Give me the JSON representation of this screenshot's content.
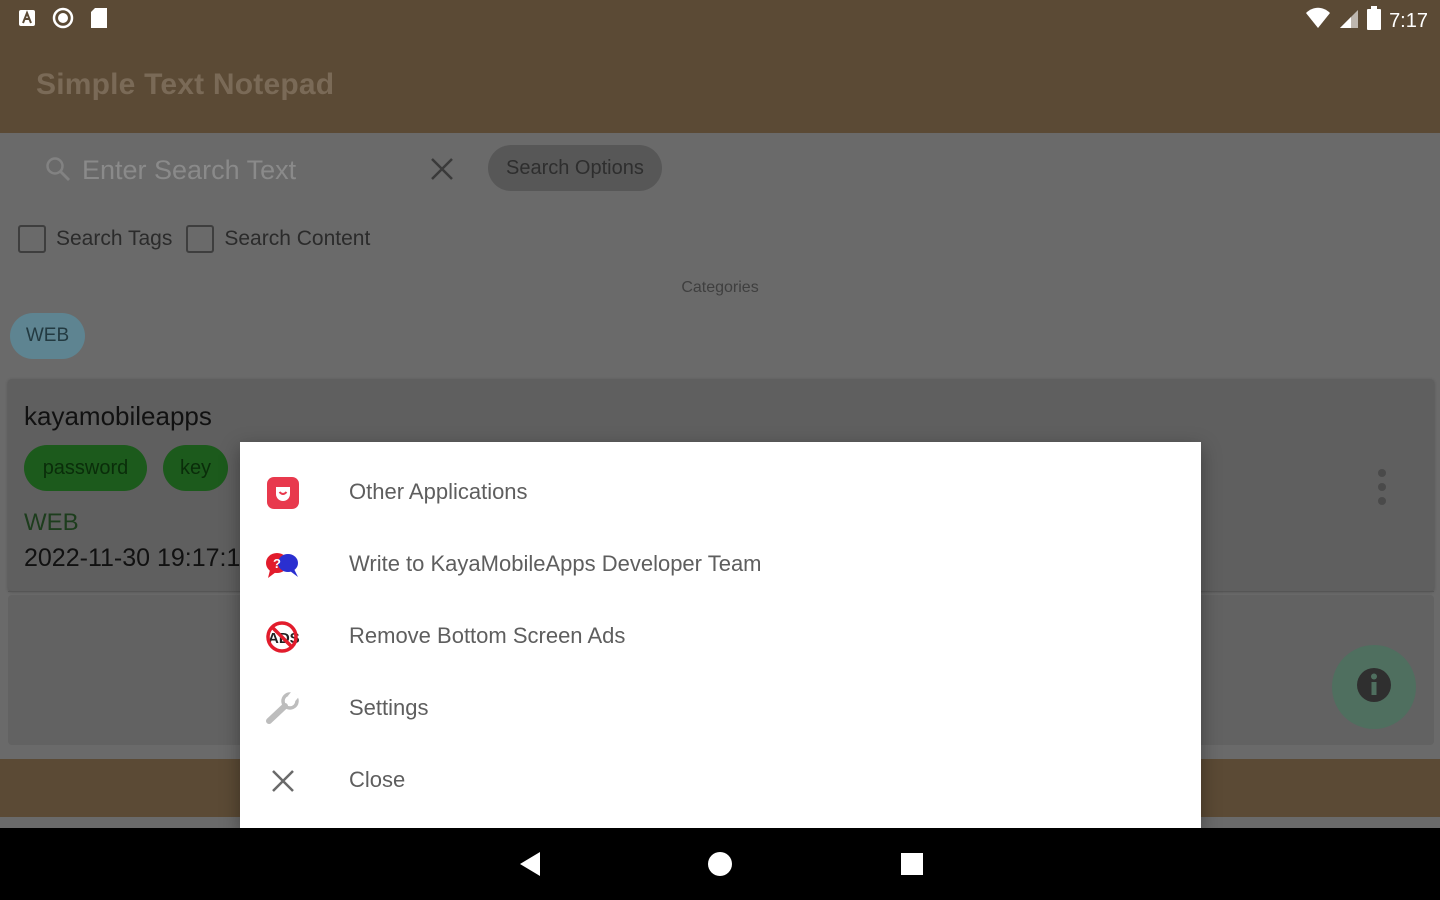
{
  "status_bar": {
    "time": "7:17",
    "left_icons": [
      "font-icon",
      "circle-icon",
      "sd-card-icon"
    ],
    "right_icons": [
      "wifi-icon",
      "signal-icon",
      "battery-icon"
    ]
  },
  "app_bar": {
    "title": "Simple Text Notepad"
  },
  "search": {
    "placeholder": "Enter Search Text",
    "options_label": "Search Options"
  },
  "filters": {
    "search_tags": {
      "label": "Search Tags",
      "checked": false
    },
    "search_content": {
      "label": "Search Content",
      "checked": false
    }
  },
  "categories": {
    "label": "Categories",
    "items": [
      "WEB"
    ]
  },
  "note": {
    "title": "kayamobileapps",
    "tags": [
      "password",
      "key"
    ],
    "category": "WEB",
    "date": "2022-11-30 19:17:1"
  },
  "menu": {
    "items": [
      {
        "label": "Other Applications",
        "icon": "store-icon"
      },
      {
        "label": "Write to KayaMobileApps Developer Team",
        "icon": "chat-icon"
      },
      {
        "label": "Remove Bottom Screen Ads",
        "icon": "no-ads-icon"
      },
      {
        "label": "Settings",
        "icon": "wrench-icon"
      },
      {
        "label": "Close",
        "icon": "close-icon"
      }
    ]
  },
  "colors": {
    "app_bar": "#5b4a35",
    "tag_green": "#1c5a1c",
    "category_chip": "#5e8491",
    "scrim": "#6a6a6a"
  }
}
